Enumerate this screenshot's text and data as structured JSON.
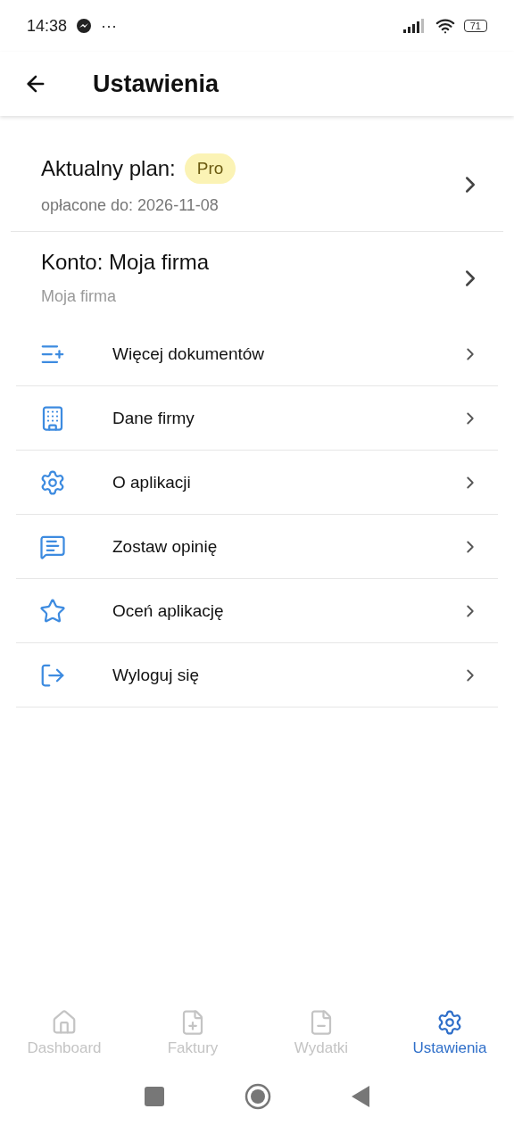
{
  "status_bar": {
    "time": "14:38",
    "more": "···",
    "battery": "71"
  },
  "header": {
    "title": "Ustawienia"
  },
  "plan": {
    "label": "Aktualny plan:",
    "badge": "Pro",
    "subtitle": "opłacone do: 2026-11-08"
  },
  "account": {
    "title": "Konto: Moja firma",
    "subtitle": "Moja firma"
  },
  "menu": [
    {
      "label": "Więcej dokumentów"
    },
    {
      "label": "Dane firmy"
    },
    {
      "label": "O aplikacji"
    },
    {
      "label": "Zostaw opinię"
    },
    {
      "label": "Oceń aplikację"
    },
    {
      "label": "Wyloguj się"
    }
  ],
  "bottom_nav": [
    {
      "label": "Dashboard",
      "selected": false
    },
    {
      "label": "Faktury",
      "selected": false
    },
    {
      "label": "Wydatki",
      "selected": false
    },
    {
      "label": "Ustawienia",
      "selected": true
    }
  ]
}
